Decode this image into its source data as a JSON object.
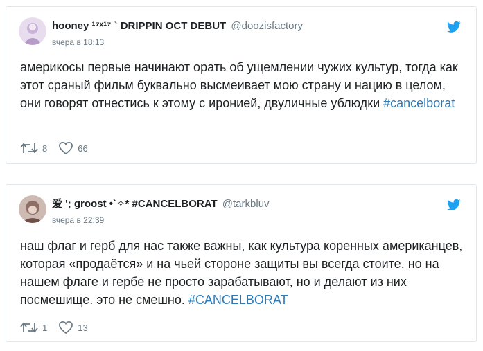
{
  "tweets": [
    {
      "name": "hooney ¹⁷ˣ¹⁷ ˋ DRIPPIN OCT DEBUT",
      "handle": "@doozisfactory",
      "time": "вчера в 18:13",
      "text": "америкосы первые начинают орать об ущемлении чужих культур, тогда как этот сраный фильм буквально высмеивает мою страну и нацию в целом, они говорят отнестись к этому с иронией, двуличные ублюдки ",
      "hashtag": "#cancelborat",
      "retweets": "8",
      "likes": "66",
      "avatar_color": "#c9b3d6"
    },
    {
      "name": "爱 '; groost •`✧* #CANCELBORAT",
      "handle": "@tarkbluv",
      "time": "вчера в 22:39",
      "text": "наш флаг и герб для нас также важны, как культура коренных американцев, которая «продаётся» и на чьей стороне защиты вы всегда стоите. но на нашем флаге и гербе не просто зарабатывают, но и делают из них посмешище. это не смешно. ",
      "hashtag": "#CANCELBORAT",
      "retweets": "1",
      "likes": "13",
      "avatar_color": "#a88e86"
    }
  ],
  "colors": {
    "link": "#2b7bb9",
    "twitter_blue": "#1da1f2",
    "muted": "#697882",
    "border": "#e1e8ed"
  },
  "icons": [
    "twitter-bird-icon",
    "retweet-icon",
    "heart-icon"
  ]
}
